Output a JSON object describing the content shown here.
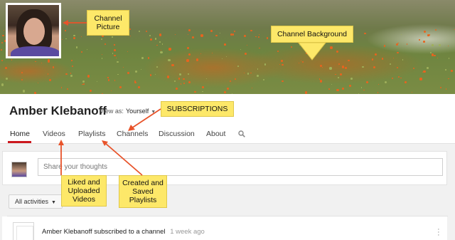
{
  "callouts": {
    "channel_picture": "Channel Picture",
    "channel_background": "Channel Background",
    "subscriptions": "SUBSCRIPTIONS",
    "liked_uploaded": "Liked and Uploaded Videos",
    "created_saved": "Created and Saved Playlists"
  },
  "header": {
    "channel_name": "Amber Klebanoff",
    "view_as_label": "View as:",
    "view_as_value": "Yourself"
  },
  "tabs": [
    {
      "label": "Home",
      "active": true
    },
    {
      "label": "Videos"
    },
    {
      "label": "Playlists"
    },
    {
      "label": "Channels"
    },
    {
      "label": "Discussion"
    },
    {
      "label": "About"
    }
  ],
  "feed": {
    "post_placeholder": "Share your thoughts",
    "activities_filter": "All activities",
    "activity": {
      "user": "Amber Klebanoff",
      "action": "subscribed to a channel",
      "time": "1 week ago"
    }
  },
  "colors": {
    "accent": "#cc181e",
    "callout_bg": "#fde869",
    "arrow": "#e8532a"
  },
  "icons": [
    "search-icon",
    "caret-down-icon",
    "more-vert-icon"
  ]
}
